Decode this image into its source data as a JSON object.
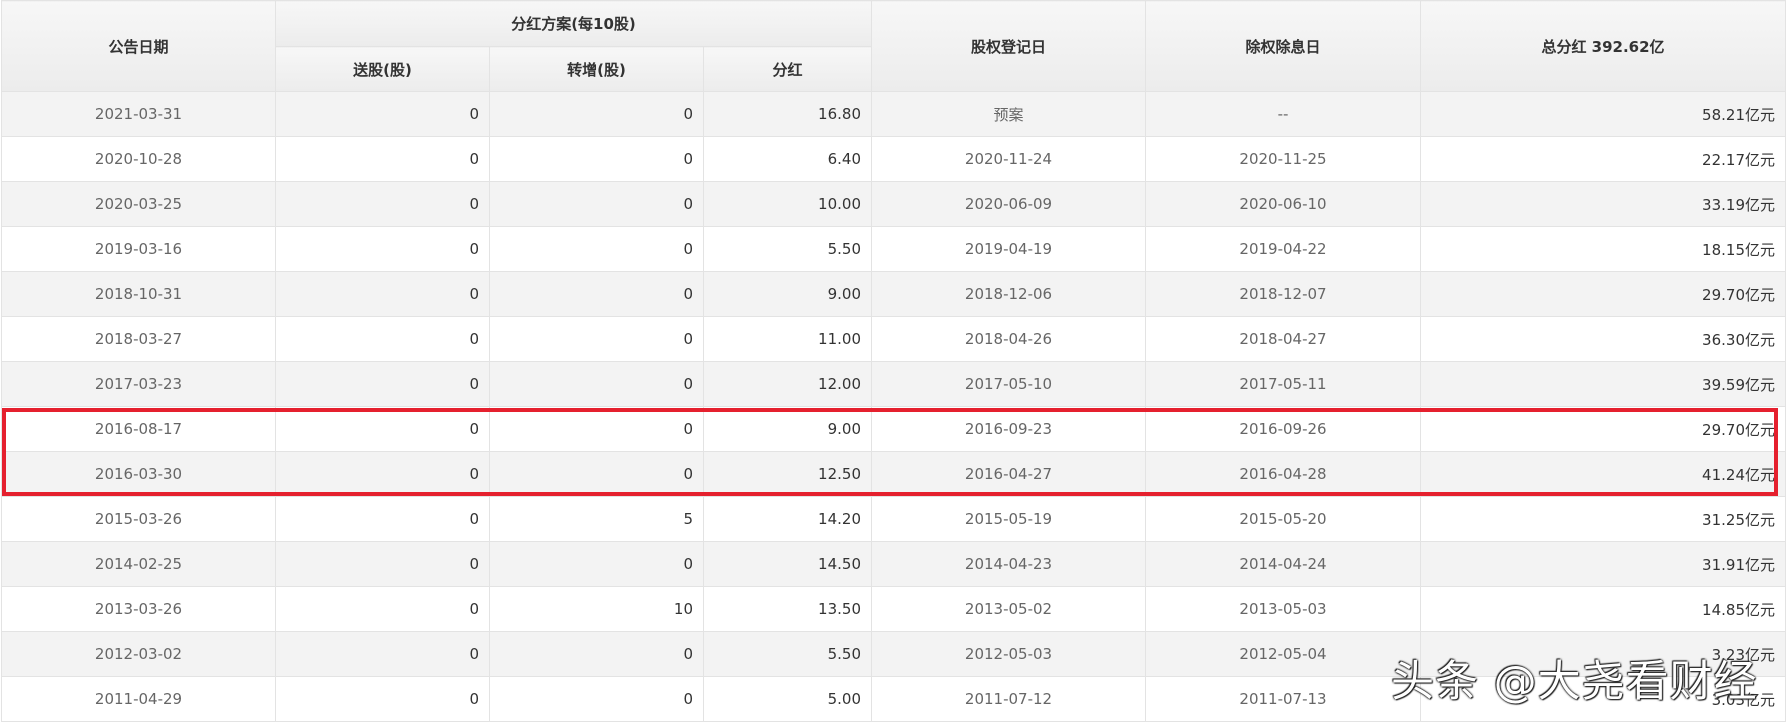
{
  "header": {
    "announce_date": "公告日期",
    "plan_group": "分红方案(每10股)",
    "bonus_shares": "送股(股)",
    "transfer_shares": "转增(股)",
    "dividend": "分红",
    "record_date": "股权登记日",
    "ex_date": "除权除息日",
    "total": "总分红 392.62亿"
  },
  "rows": [
    {
      "date": "2021-03-31",
      "bonus": "0",
      "transfer": "0",
      "dividend": "16.80",
      "record": "预案",
      "ex": "--",
      "total": "58.21亿元"
    },
    {
      "date": "2020-10-28",
      "bonus": "0",
      "transfer": "0",
      "dividend": "6.40",
      "record": "2020-11-24",
      "ex": "2020-11-25",
      "total": "22.17亿元"
    },
    {
      "date": "2020-03-25",
      "bonus": "0",
      "transfer": "0",
      "dividend": "10.00",
      "record": "2020-06-09",
      "ex": "2020-06-10",
      "total": "33.19亿元"
    },
    {
      "date": "2019-03-16",
      "bonus": "0",
      "transfer": "0",
      "dividend": "5.50",
      "record": "2019-04-19",
      "ex": "2019-04-22",
      "total": "18.15亿元"
    },
    {
      "date": "2018-10-31",
      "bonus": "0",
      "transfer": "0",
      "dividend": "9.00",
      "record": "2018-12-06",
      "ex": "2018-12-07",
      "total": "29.70亿元"
    },
    {
      "date": "2018-03-27",
      "bonus": "0",
      "transfer": "0",
      "dividend": "11.00",
      "record": "2018-04-26",
      "ex": "2018-04-27",
      "total": "36.30亿元"
    },
    {
      "date": "2017-03-23",
      "bonus": "0",
      "transfer": "0",
      "dividend": "12.00",
      "record": "2017-05-10",
      "ex": "2017-05-11",
      "total": "39.59亿元"
    },
    {
      "date": "2016-08-17",
      "bonus": "0",
      "transfer": "0",
      "dividend": "9.00",
      "record": "2016-09-23",
      "ex": "2016-09-26",
      "total": "29.70亿元"
    },
    {
      "date": "2016-03-30",
      "bonus": "0",
      "transfer": "0",
      "dividend": "12.50",
      "record": "2016-04-27",
      "ex": "2016-04-28",
      "total": "41.24亿元"
    },
    {
      "date": "2015-03-26",
      "bonus": "0",
      "transfer": "5",
      "dividend": "14.20",
      "record": "2015-05-19",
      "ex": "2015-05-20",
      "total": "31.25亿元"
    },
    {
      "date": "2014-02-25",
      "bonus": "0",
      "transfer": "0",
      "dividend": "14.50",
      "record": "2014-04-23",
      "ex": "2014-04-24",
      "total": "31.91亿元"
    },
    {
      "date": "2013-03-26",
      "bonus": "0",
      "transfer": "10",
      "dividend": "13.50",
      "record": "2013-05-02",
      "ex": "2013-05-03",
      "total": "14.85亿元"
    },
    {
      "date": "2012-03-02",
      "bonus": "0",
      "transfer": "0",
      "dividend": "5.50",
      "record": "2012-05-03",
      "ex": "2012-05-04",
      "total": "3.23亿元"
    },
    {
      "date": "2011-04-29",
      "bonus": "0",
      "transfer": "0",
      "dividend": "5.00",
      "record": "2011-07-12",
      "ex": "2011-07-13",
      "total": "3.03亿元"
    }
  ],
  "highlight_color": "#e5202e",
  "watermark": "头条 @大尧看财经"
}
